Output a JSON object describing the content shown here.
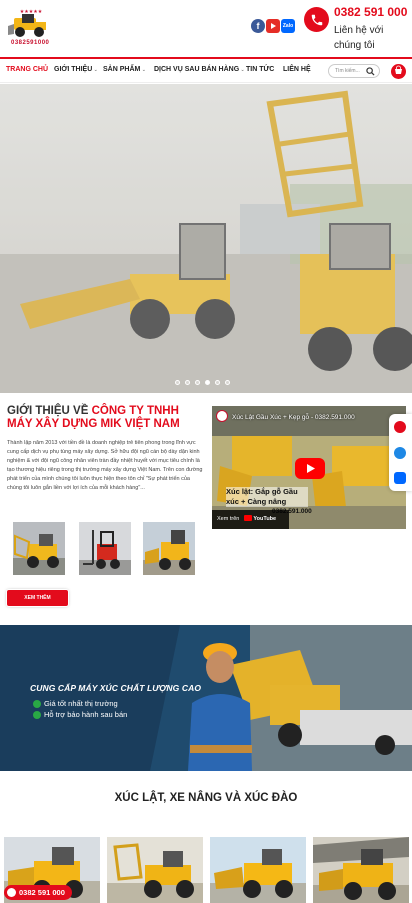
{
  "header": {
    "logo_text": "0382591000",
    "phone_number": "0382 591 000",
    "phone_caption": "Liên hệ với chúng tôi",
    "social": [
      {
        "icon": "facebook-icon",
        "color": "#3b5998"
      },
      {
        "icon": "youtube-icon",
        "color": "#e52d27"
      },
      {
        "icon": "zalo-icon",
        "color": "#0068ff"
      }
    ]
  },
  "nav": {
    "items": [
      {
        "label": "TRANG CHỦ",
        "active": true
      },
      {
        "label": "GIỚI THIỆU",
        "dropdown": true
      },
      {
        "label": "SẢN PHẨM",
        "dropdown": true
      },
      {
        "label": "DỊCH VỤ SAU BÁN HÀNG",
        "dropdown": true
      },
      {
        "label": "TIN TỨC"
      },
      {
        "label": "LIÊN HỆ"
      }
    ],
    "search_placeholder": "Tìm kiếm..."
  },
  "hero": {
    "slides_count": 6,
    "active_slide": 4
  },
  "intro": {
    "title_prefix": "GIỚI THIỆU VỀ ",
    "title_company": "CÔNG TY TNHH MÁY XÂY DỰNG MIK VIỆT NAM",
    "body": "Thành lập năm 2013 với tiền đề là doanh nghiệp trẻ tiên phong trong lĩnh vực cung cấp dịch vụ phụ tùng máy xây dựng. Sở hữu đội ngũ cán bộ dày dặn kinh nghiệm & với đội ngũ công nhân viên tràn đầy nhiệt huyết với mục tiêu chính là tạo thương hiệu riêng trong thị trường máy xây dựng Việt Nam. Trên con đường phát triển của mình chúng tôi luôn thực hiện theo tôn chỉ \"Sự phát triển của chúng tôi luôn gắn liền với lợi ích của mỗi khách hàng\"...",
    "more_button": "XEM THÊM"
  },
  "video": {
    "title": "Xúc Lật Gầu Xúc + Kẹp gỗ - 0382.591.000",
    "overlay_text": "Xúc lật: Gắp gỗ Gầu xúc + Càng nâng",
    "overlay_phone": "0382.591.000",
    "watch_on": "Xem trên",
    "platform": "YouTube"
  },
  "banner": {
    "title": "CUNG CẤP MÁY XÚC CHẤT LƯỢNG CAO",
    "items": [
      "Giá tốt nhất thị trường",
      "Hỗ trợ bảo hành sau bán"
    ]
  },
  "products": {
    "section_title": "XÚC LẬT, XE NÂNG VÀ XÚC ĐÀO",
    "phone_badge": "0382 591 000"
  },
  "colors": {
    "accent": "#e30b1c",
    "machine_yellow": "#f3b617",
    "banner_blue": "#1c4466"
  }
}
